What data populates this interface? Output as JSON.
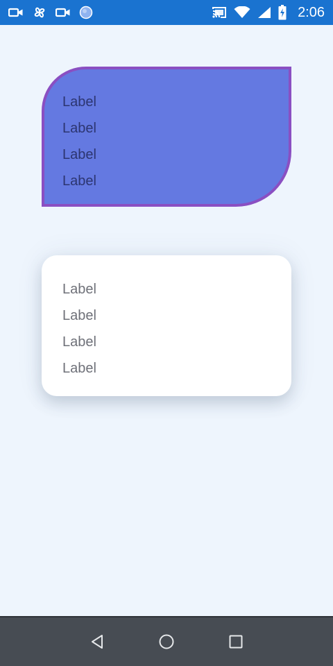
{
  "status_bar": {
    "time": "2:06",
    "left_icons": [
      "video-camera-icon",
      "pinwheel-icon",
      "video-camera-icon",
      "circle-app-icon"
    ],
    "right_icons": [
      "cast-icon",
      "wifi-icon",
      "cell-signal-icon",
      "battery-charging-icon"
    ],
    "background": "#1a73d0"
  },
  "cards": {
    "shaped": {
      "labels": [
        "Label",
        "Label",
        "Label",
        "Label"
      ],
      "fill": "#6479e1",
      "stroke": "#8a4fc2"
    },
    "elevated": {
      "labels": [
        "Label",
        "Label",
        "Label",
        "Label"
      ],
      "fill": "#ffffff"
    }
  },
  "nav_bar": {
    "buttons": [
      "back-icon",
      "home-icon",
      "recents-icon"
    ],
    "background": "#474c53"
  },
  "colors": {
    "page_background": "#eef5fd"
  }
}
